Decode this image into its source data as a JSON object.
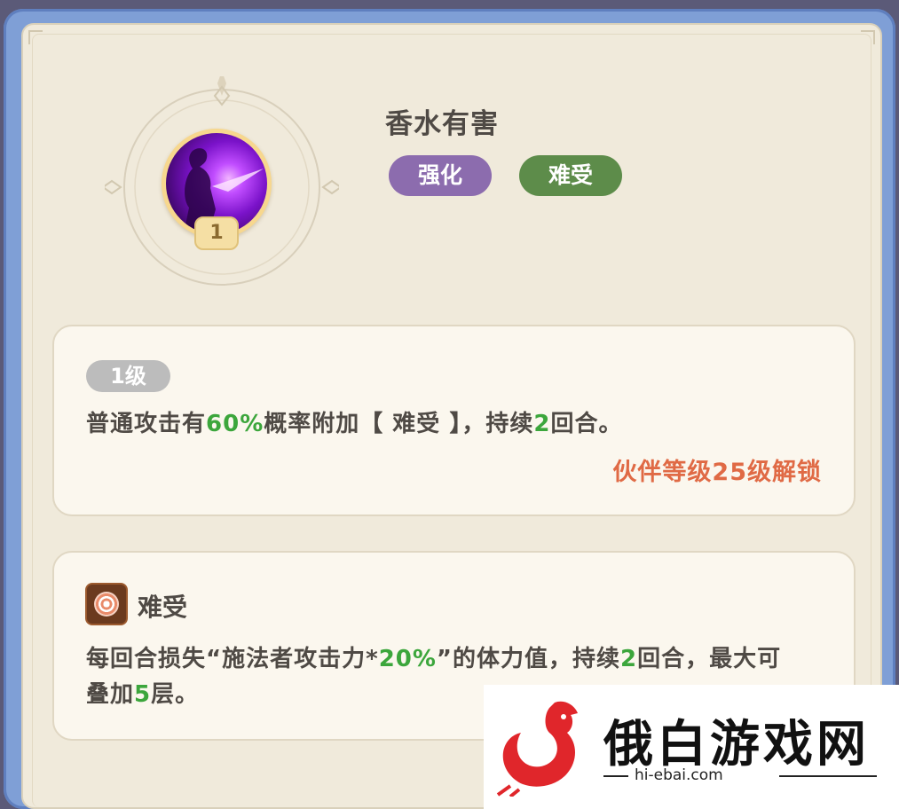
{
  "skill": {
    "name": "香水有害",
    "level_number": "1",
    "tags": [
      {
        "label": "强化",
        "color": "#8c6cae"
      },
      {
        "label": "难受",
        "color": "#5d8c4a"
      }
    ]
  },
  "level_panel": {
    "badge": "1级",
    "desc_parts": [
      "普通攻击有",
      "60%",
      "概率附加【 难受 】，持续",
      "2",
      "回合。"
    ],
    "unlock_text": "伙伴等级25级解锁"
  },
  "effect_panel": {
    "icon": "debuff-swirl-icon",
    "title": "难受",
    "desc_parts": [
      "每回合损失“施法者攻击力*",
      "20%",
      "”的体力值，持续",
      "2",
      "回合，最大可叠加",
      "5",
      "层。"
    ]
  },
  "watermark": {
    "name": "俄白游戏网",
    "url": "hi-ebai.com",
    "logo": "rooster-logo-icon"
  },
  "colors": {
    "highlight": "#3ca63c",
    "unlock": "#e06a45"
  }
}
